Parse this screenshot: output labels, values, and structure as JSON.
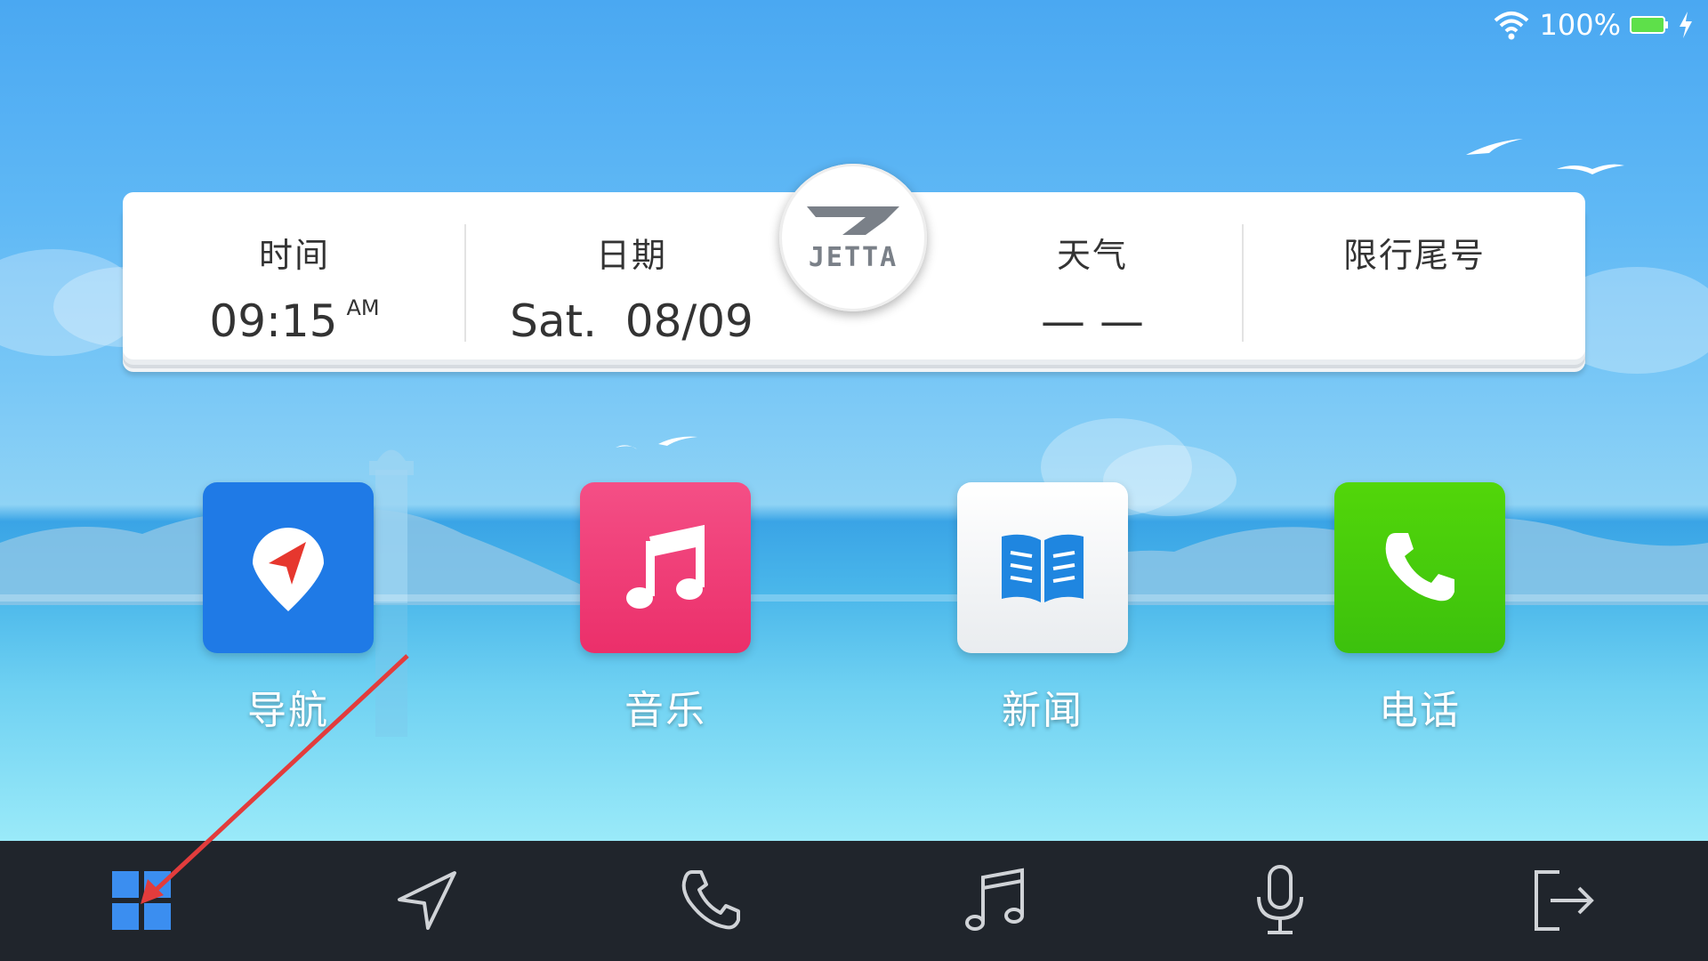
{
  "status_bar": {
    "battery_text": "100%",
    "icons": [
      "wifi-icon",
      "battery-icon",
      "charging-icon"
    ]
  },
  "info_card": {
    "time": {
      "label": "时间",
      "value": "09:15",
      "ampm": "AM"
    },
    "date": {
      "label": "日期",
      "value": "Sat.  08/09"
    },
    "logo": {
      "text": "JETTA"
    },
    "weather": {
      "label": "天气",
      "value": "— —"
    },
    "restriction": {
      "label": "限行尾号",
      "value": ""
    }
  },
  "apps": [
    {
      "label": "导航",
      "icon": "navigation-icon",
      "color": "#1f7ae6"
    },
    {
      "label": "音乐",
      "icon": "music-icon",
      "color": "#f0477c"
    },
    {
      "label": "新闻",
      "icon": "news-icon",
      "color": "#f3f5f7"
    },
    {
      "label": "电话",
      "icon": "phone-icon",
      "color": "#43c90b"
    }
  ],
  "dock": {
    "items": [
      "apps-grid-icon",
      "navigate-arrow-icon",
      "phone-icon",
      "music-note-icon",
      "microphone-icon",
      "exit-icon"
    ],
    "active": "apps-grid-icon",
    "active_color": "#3b8ef0"
  },
  "annotation": {
    "type": "red-arrow",
    "target": "apps-grid-icon",
    "color": "#e23c3c"
  }
}
